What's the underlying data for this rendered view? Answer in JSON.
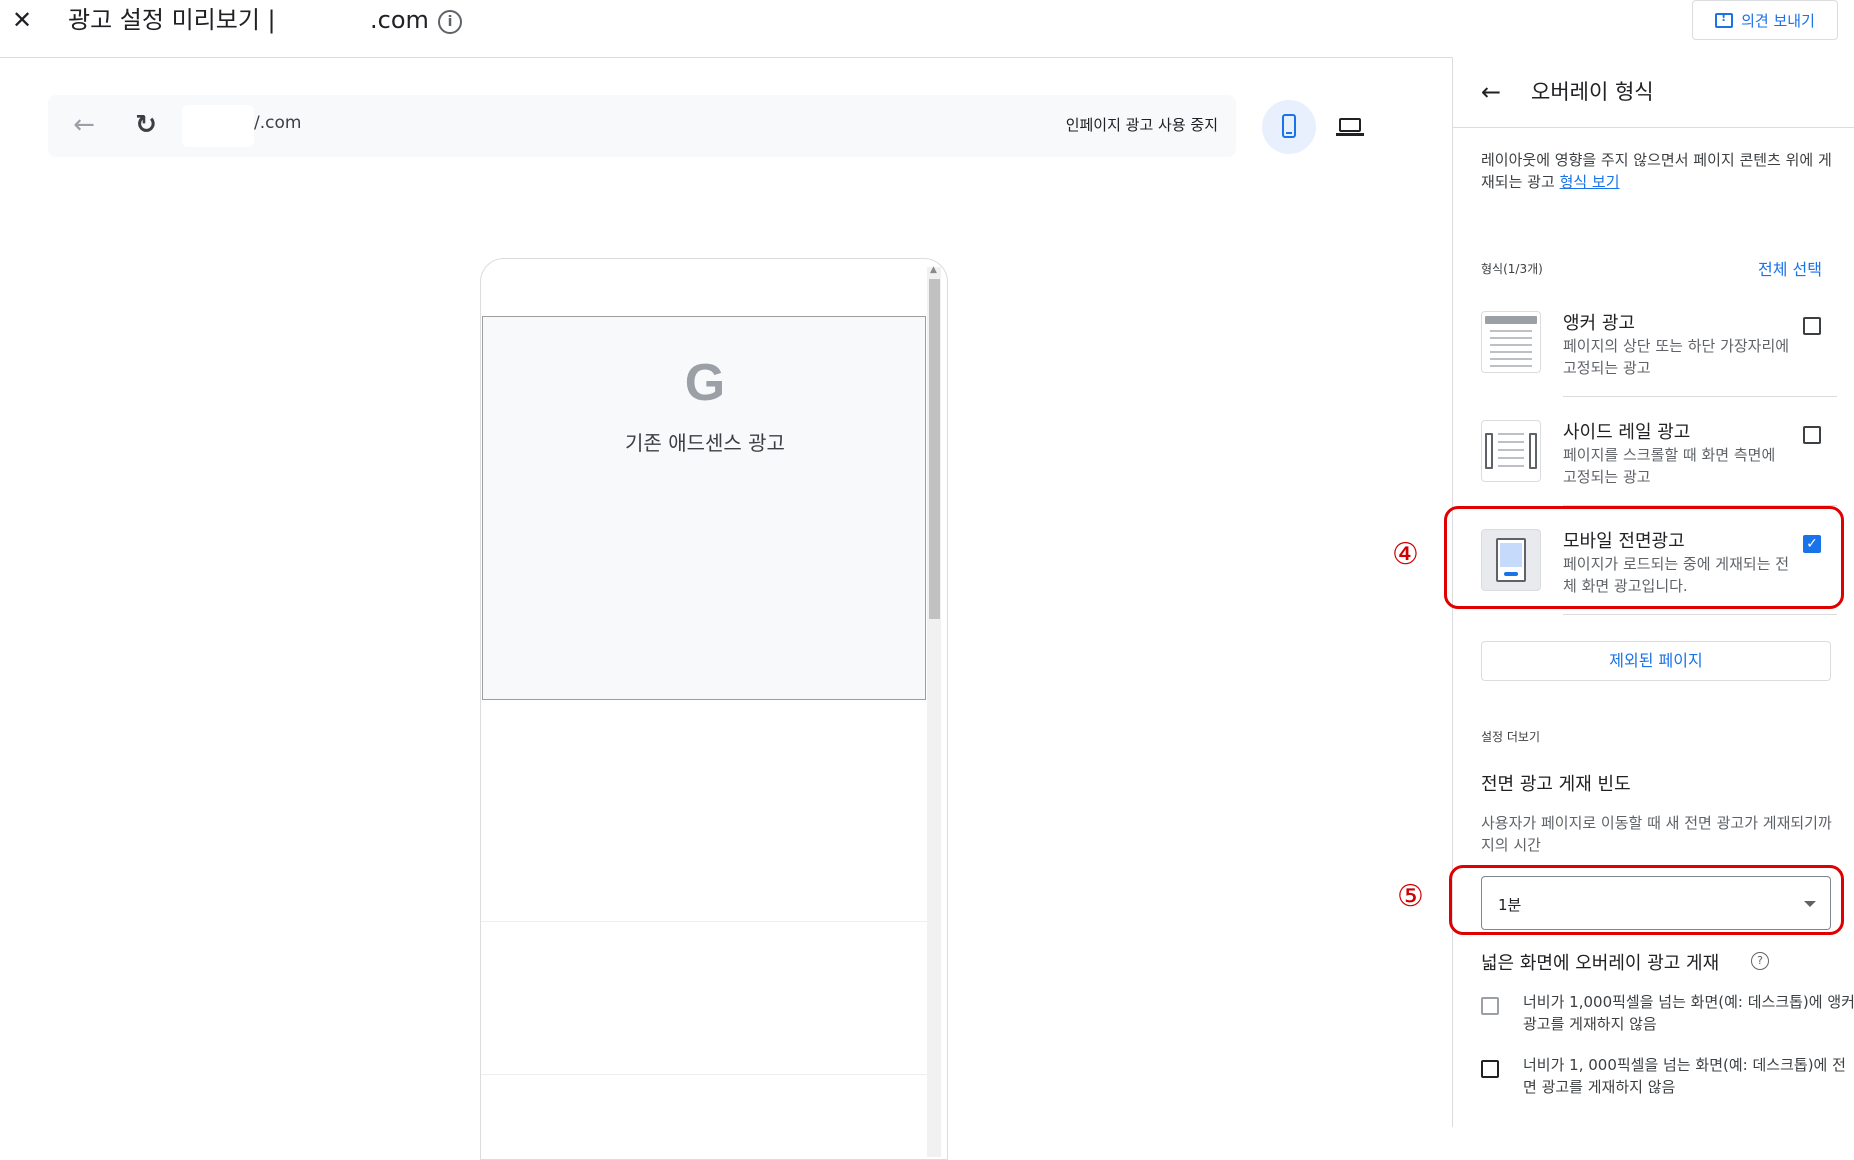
{
  "topbar": {
    "close_label": "✕",
    "title": "광고 설정 미리보기 |",
    "domain_suffix": ".com",
    "info_glyph": "i",
    "feedback_label": "의견 보내기"
  },
  "preview": {
    "back_glyph": "←",
    "reload_glyph": "↻",
    "url_text": "/.com",
    "stop_inpage_label": "인페이지 광고 사용 중지",
    "ad_logo": "G",
    "ad_label": "기존 애드센스 광고"
  },
  "panel": {
    "back_glyph": "←",
    "title": "오버레이 형식",
    "description": "레이아웃에 영향을 주지 않으면서 페이지 콘텐츠 위에 게재되는 광고",
    "description_link": "형식 보기",
    "format_count": "형식(1/3개)",
    "select_all": "전체 선택",
    "formats": [
      {
        "title": "앵커 광고",
        "desc": "페이지의 상단 또는 하단 가장자리에 고정되는 광고",
        "checked": false
      },
      {
        "title": "사이드 레일 광고",
        "desc": "페이지를 스크롤할 때 화면 측면에 고정되는 광고",
        "checked": false
      },
      {
        "title": "모바일 전면광고",
        "desc": "페이지가 로드되는 중에 게재되는 전체 화면 광고입니다.",
        "checked": true
      }
    ],
    "excluded_pages": "제외된 페이지",
    "more_settings": "설정 더보기",
    "freq_title": "전면 광고 게재 빈도",
    "freq_desc": "사용자가 페이지로 이동할 때 새 전면 광고가 게재되기까지의 시간",
    "freq_value": "1분",
    "wide_title": "넓은 화면에 오버레이 광고 게재",
    "wide_help": "?",
    "wide_options": [
      {
        "text": "너비가 1,000픽셀을 넘는 화면(예: 데스크톱)에 앵커 광고를 게재하지 않음",
        "checked": false
      },
      {
        "text": "너비가 1, 000픽셀을 넘는 화면(예: 데스크톱)에 전면 광고를 게재하지 않음",
        "checked": false
      }
    ]
  },
  "annotations": {
    "num4": "④",
    "num5": "⑤"
  },
  "colors": {
    "accent": "#1a73e8",
    "annotation_red": "#e00000"
  }
}
